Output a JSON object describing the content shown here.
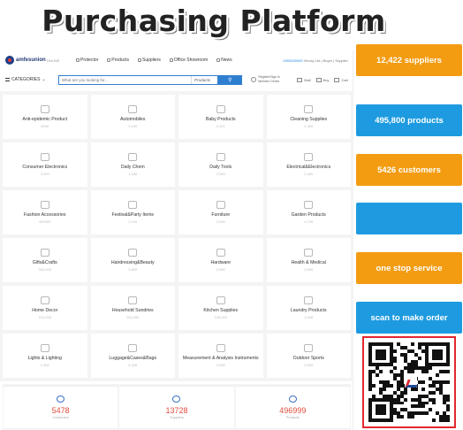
{
  "title": "Purchasing Platform",
  "header": {
    "logo_text": "amfesunion",
    "logo_sub": "ONLINE",
    "nav": [
      "Protector",
      "Products",
      "Suppliers",
      "Office Showroom",
      "News"
    ],
    "top_right_phone": "0000000000",
    "top_right_text": "Vincey Ltd | Buyer | Supplier"
  },
  "search": {
    "categories_label": "CATEGORIES",
    "placeholder": "What are you looking for...",
    "product_select": "Products",
    "util_1": "Register/Sign In Member Center",
    "util_2": "Mall",
    "util_3": "Buy",
    "util_4": "Cart"
  },
  "categories": [
    {
      "label": "Anti-epidemic Product",
      "count": "0000"
    },
    {
      "label": "Automobiles",
      "count": "3,160"
    },
    {
      "label": "Baby Products",
      "count": "2,021"
    },
    {
      "label": "Cleaning Supplies",
      "count": "2,400"
    },
    {
      "label": "Consumer Electronics",
      "count": "3,200"
    },
    {
      "label": "Daily Chem",
      "count": "1,150"
    },
    {
      "label": "Daily Tools",
      "count": "2,000"
    },
    {
      "label": "Electrical&Electronics",
      "count": "3,450"
    },
    {
      "label": "Fashion Accessories",
      "count": "400000"
    },
    {
      "label": "Festival&Party Items",
      "count": "2,105"
    },
    {
      "label": "Furniture",
      "count": "2,000"
    },
    {
      "label": "Garden Products",
      "count": "4,720"
    },
    {
      "label": "Gifts&Crafts",
      "count": "300,000"
    },
    {
      "label": "Hairdressing&Beauty",
      "count": "3,800"
    },
    {
      "label": "Hardware",
      "count": "2,000"
    },
    {
      "label": "Health & Medical",
      "count": "3,000"
    },
    {
      "label": "Home Decor",
      "count": "101,000"
    },
    {
      "label": "Household Sundries",
      "count": "100,000"
    },
    {
      "label": "Kitchen Supplies",
      "count": "100,000"
    },
    {
      "label": "Laundry Products",
      "count": "1,000"
    },
    {
      "label": "Lights & Lighting",
      "count": "1,400"
    },
    {
      "label": "Luggage&Cases&Bags",
      "count": "4,200"
    },
    {
      "label": "Measurement & Analysis Instruments",
      "count": "2,000"
    },
    {
      "label": "Outdoor Sports",
      "count": "2,000"
    }
  ],
  "stats": [
    {
      "value": "5478",
      "label": "Customers"
    },
    {
      "value": "13728",
      "label": "Suppliers"
    },
    {
      "value": "496999",
      "label": "Products"
    }
  ],
  "side_buttons": [
    {
      "label": "12,422 suppliers",
      "color": "#f39c12"
    },
    {
      "label": "495,800 products",
      "color": "#1e9be0"
    },
    {
      "label": "5426 customers",
      "color": "#f39c12"
    },
    {
      "label": "",
      "color": "#1e9be0"
    },
    {
      "label": "one stop service",
      "color": "#f39c12"
    },
    {
      "label": "scan to make order",
      "color": "#1e9be0"
    }
  ],
  "colors": {
    "orange": "#f39c12",
    "blue": "#1e9be0",
    "qr_border": "#e3262d",
    "stat_value": "#e24c3c"
  }
}
